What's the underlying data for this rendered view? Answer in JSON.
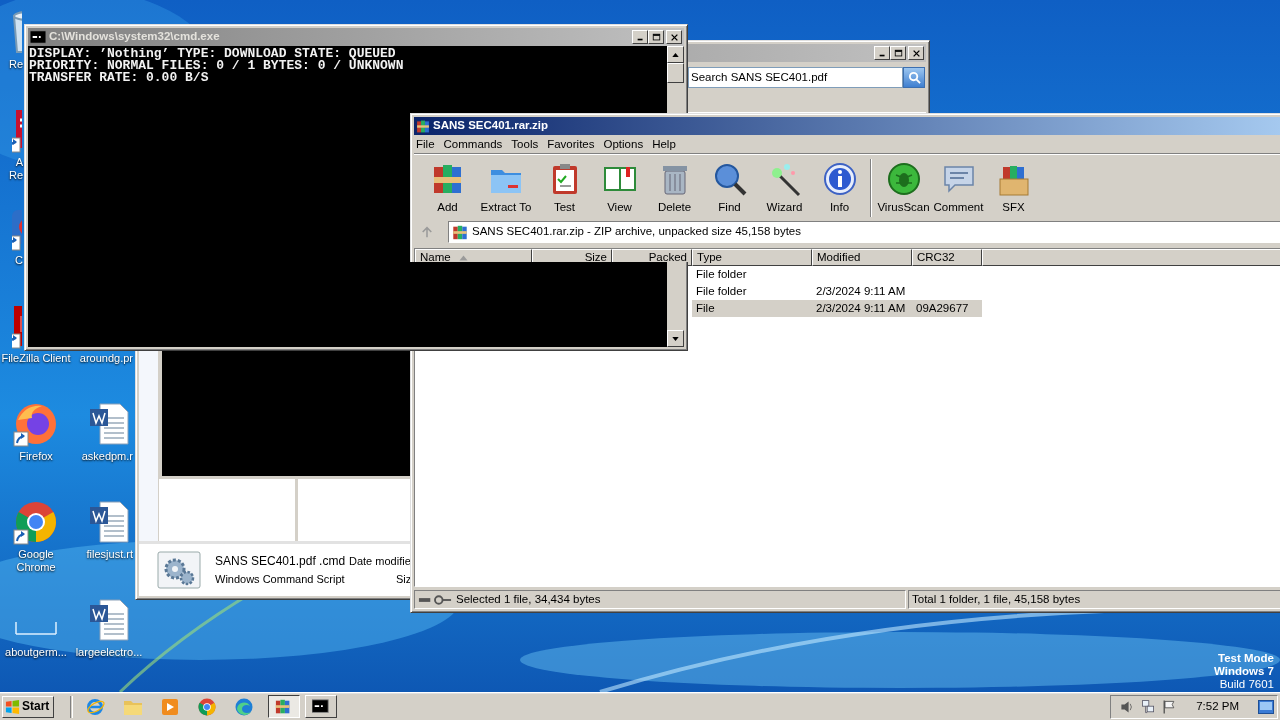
{
  "desktop": {
    "column_1": [
      {
        "kind": "recycle",
        "shortcut": false,
        "covered": true,
        "label": [
          "Re"
        ],
        "cut": true
      },
      {
        "kind": "pdf",
        "shortcut": true,
        "covered": true,
        "label": [
          "A",
          "Re"
        ],
        "cut": true
      },
      {
        "kind": "app",
        "shortcut": true,
        "covered": true,
        "label": [
          "C"
        ],
        "cut": true
      },
      {
        "kind": "filezilla",
        "shortcut": true,
        "covered": true,
        "label": [
          "FileZilla Client"
        ],
        "cut": false
      },
      {
        "kind": "firefox",
        "shortcut": true,
        "covered": false,
        "label": [
          "Firefox"
        ],
        "cut": false
      },
      {
        "kind": "chrome",
        "shortcut": true,
        "covered": false,
        "label": [
          "Google",
          "Chrome"
        ],
        "cut": false
      },
      {
        "kind": "blank",
        "shortcut": false,
        "covered": false,
        "label": [
          "aboutgerm..."
        ],
        "cut": false
      }
    ],
    "column_2": [
      {
        "label": [
          "aroundg.pr"
        ],
        "cut": true
      },
      {
        "kind": "word",
        "label": [
          "askedpm.r"
        ],
        "cut": true
      },
      {
        "kind": "word",
        "label": [
          "filesjust.rt"
        ],
        "cut": true
      },
      {
        "kind": "word",
        "label": [
          "largeelectro..."
        ],
        "cut": false
      }
    ]
  },
  "explorer": {
    "search": {
      "placeholder": "Search SANS SEC401.pdf"
    },
    "details": {
      "file_name": "SANS SEC401.pdf .cmd",
      "date_label": "Date modifie",
      "file_type": "Windows Command Script",
      "size_label": "Siz"
    }
  },
  "winrar": {
    "title": "SANS SEC401.rar.zip",
    "menu": [
      "File",
      "Commands",
      "Tools",
      "Favorites",
      "Options",
      "Help"
    ],
    "toolbar_groups": [
      [
        {
          "kind": "add",
          "label": "Add"
        },
        {
          "kind": "extract",
          "label": "Extract To"
        },
        {
          "kind": "test",
          "label": "Test"
        },
        {
          "kind": "view",
          "label": "View"
        },
        {
          "kind": "delete",
          "label": "Delete"
        },
        {
          "kind": "find",
          "label": "Find"
        },
        {
          "kind": "wizard",
          "label": "Wizard"
        },
        {
          "kind": "info",
          "label": "Info"
        }
      ],
      [
        {
          "kind": "virus",
          "label": "VirusScan"
        },
        {
          "kind": "comment",
          "label": "Comment"
        },
        {
          "kind": "sfx",
          "label": "SFX"
        }
      ]
    ],
    "path": "SANS SEC401.rar.zip - ZIP archive, unpacked size 45,158 bytes",
    "columns": [
      {
        "label": "Name",
        "kind": "text",
        "sorted": true
      },
      {
        "label": "Size",
        "kind": "number",
        "sorted": false
      },
      {
        "label": "Packed",
        "kind": "number",
        "sorted": false
      },
      {
        "label": "Type",
        "kind": "text",
        "sorted": false
      },
      {
        "label": "Modified",
        "kind": "text",
        "sorted": false
      },
      {
        "label": "CRC32",
        "kind": "text",
        "sorted": false
      }
    ],
    "rows": [
      {
        "type": "File folder",
        "selected": false
      },
      {
        "type": "File folder",
        "modified": "2/3/2024 9:11 AM",
        "selected": false
      },
      {
        "type": "File",
        "modified": "2/3/2024 9:11 AM",
        "crc32": "09A29677",
        "selected": true
      }
    ],
    "status": [
      "Selected 1 file, 34,434 bytes",
      "Total 1 folder, 1 file, 45,158 bytes"
    ]
  },
  "cmd": {
    "title": "C:\\Windows\\system32\\cmd.exe",
    "lines": [
      "DISPLAY: ’Nothing’ TYPE: DOWNLOAD STATE: QUEUED",
      "PRIORITY: NORMAL FILES: 0 / 1 BYTES: 0 / UNKNOWN",
      "TRANSFER RATE: 0.00 B/S"
    ]
  },
  "test_mode": [
    "Test Mode",
    "Windows 7",
    "Build 7601"
  ],
  "taskbar": {
    "start": "Start",
    "quick_launch": [
      {
        "kind": "ie"
      },
      {
        "kind": "explorer"
      },
      {
        "kind": "media"
      },
      {
        "kind": "chrome"
      },
      {
        "kind": "edge"
      }
    ],
    "tasks": [
      {
        "kind": "winrar",
        "selected": true
      },
      {
        "kind": "cmd",
        "selected": false
      }
    ],
    "tray_icons": [
      {
        "kind": "speaker"
      },
      {
        "kind": "network"
      },
      {
        "kind": "flag"
      }
    ],
    "clock": "7:52 PM"
  }
}
